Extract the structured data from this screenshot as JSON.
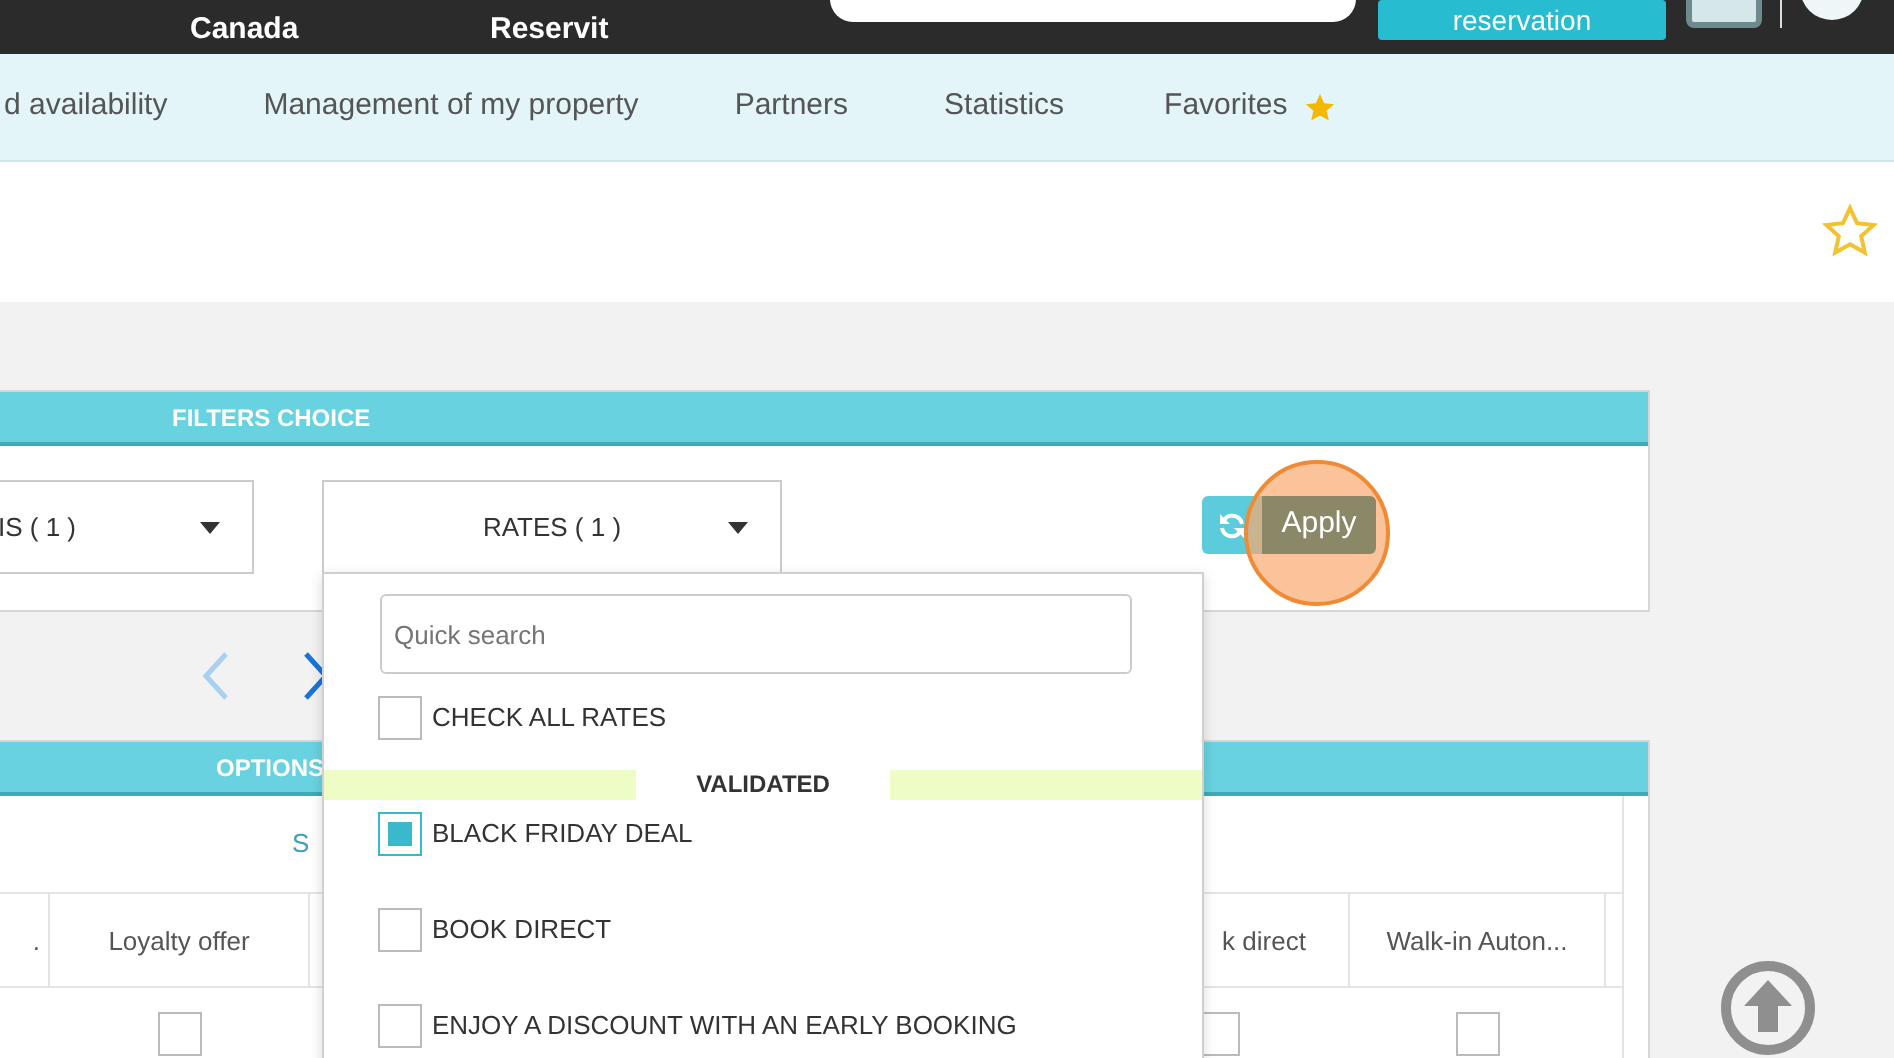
{
  "top_bar": {
    "items": [
      "Canada",
      "Reservit"
    ],
    "button": "reservation"
  },
  "nav": [
    {
      "label": "d availability"
    },
    {
      "label": "Management of my property"
    },
    {
      "label": "Partners"
    },
    {
      "label": "Statistics"
    },
    {
      "label": "Favorites",
      "starred": true
    }
  ],
  "filters": {
    "title": "FILTERS CHOICE",
    "selects": [
      "IS ( 1 )",
      "RATES ( 1 )"
    ],
    "apply": "Apply"
  },
  "options": {
    "title": "OPTIONS",
    "link": "S",
    "columns": [
      ".",
      "Loyalty offer",
      "k direct",
      "Walk-in Auton..."
    ],
    "row": [
      {
        "checked": false
      },
      {
        "checked": false
      },
      {
        "checked": false
      }
    ]
  },
  "rates_dropdown": {
    "placeholder": "Quick search",
    "check_all": {
      "label": "CHECK ALL RATES",
      "checked": false
    },
    "group": "VALIDATED",
    "items": [
      {
        "label": "BLACK FRIDAY DEAL",
        "checked": true
      },
      {
        "label": "BOOK DIRECT",
        "checked": false
      },
      {
        "label": "ENJOY A DISCOUNT WITH AN EARLY BOOKING",
        "checked": false
      }
    ]
  }
}
